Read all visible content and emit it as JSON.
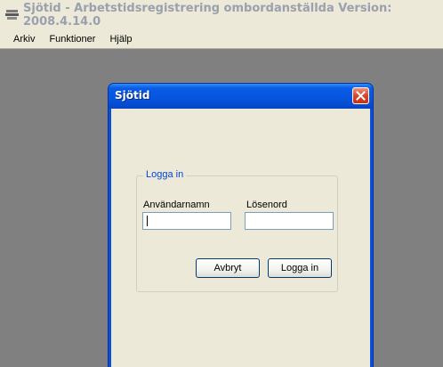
{
  "window": {
    "title": "Sjötid - Arbetstidsregistrering ombordanställda Version: 2008.4.14.0"
  },
  "menu": [
    "Arkiv",
    "Funktioner",
    "Hjälp"
  ],
  "dialog": {
    "title": "Sjötid",
    "group_label": "Logga in",
    "username_label": "Användarnamn",
    "password_label": "Lösenord",
    "username_value": "",
    "password_value": "",
    "cancel_label": "Avbryt",
    "login_label": "Logga in"
  }
}
